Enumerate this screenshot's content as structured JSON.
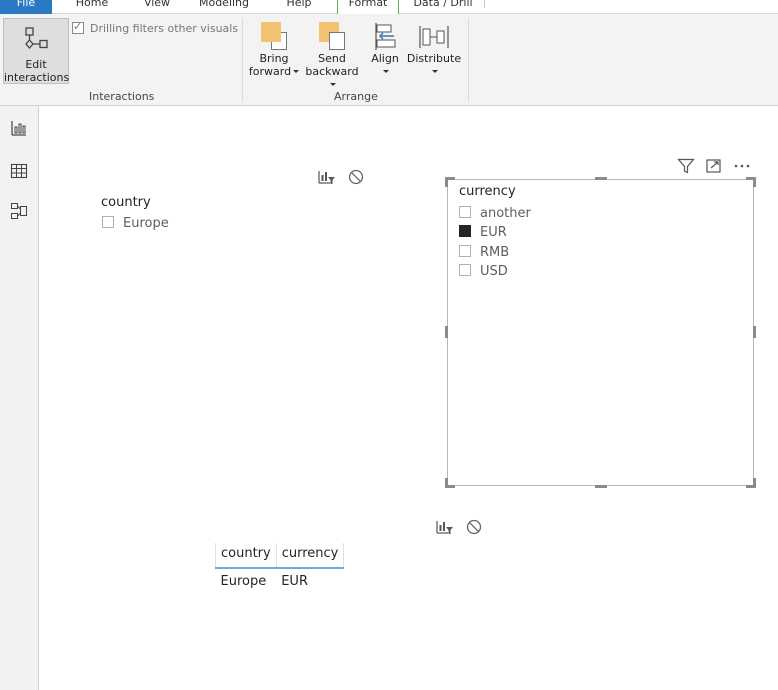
{
  "tabs": [
    {
      "label": "File"
    },
    {
      "label": "Home"
    },
    {
      "label": "View"
    },
    {
      "label": "Modeling"
    },
    {
      "label": "Help"
    },
    {
      "label": "Format"
    },
    {
      "label": "Data / Drill"
    }
  ],
  "ribbon": {
    "edit_interactions_line1": "Edit",
    "edit_interactions_line2": "interactions",
    "drilling_filters_label": "Drilling filters other visuals",
    "drilling_filters_checked": true,
    "interactions_group": "Interactions",
    "bring_forward_line1": "Bring",
    "bring_forward_line2": "forward",
    "send_backward_line1": "Send",
    "send_backward_line2": "backward",
    "align_label": "Align",
    "distribute_label": "Distribute",
    "arrange_group": "Arrange"
  },
  "slicer_country": {
    "title": "country",
    "items": [
      {
        "label": "Europe",
        "selected": false
      }
    ]
  },
  "slicer_currency": {
    "title": "currency",
    "items": [
      {
        "label": "another",
        "selected": false
      },
      {
        "label": "EUR",
        "selected": true
      },
      {
        "label": "RMB",
        "selected": false
      },
      {
        "label": "USD",
        "selected": false
      }
    ]
  },
  "table": {
    "headers": [
      "country",
      "currency"
    ],
    "rows": [
      [
        "Europe",
        "EUR"
      ]
    ]
  },
  "colors": {
    "accent_green": "#5bb64a",
    "file_tab_blue": "#2b79c5",
    "table_header_line": "#6fa8dc",
    "selected_box": "#252423"
  },
  "icons": {
    "rail": [
      "report-view-icon",
      "data-view-icon",
      "model-view-icon"
    ],
    "visual_header": [
      "filter-icon",
      "focus-mode-icon",
      "more-options-icon"
    ],
    "interaction": [
      "filter-interaction-icon",
      "none-interaction-icon"
    ]
  }
}
